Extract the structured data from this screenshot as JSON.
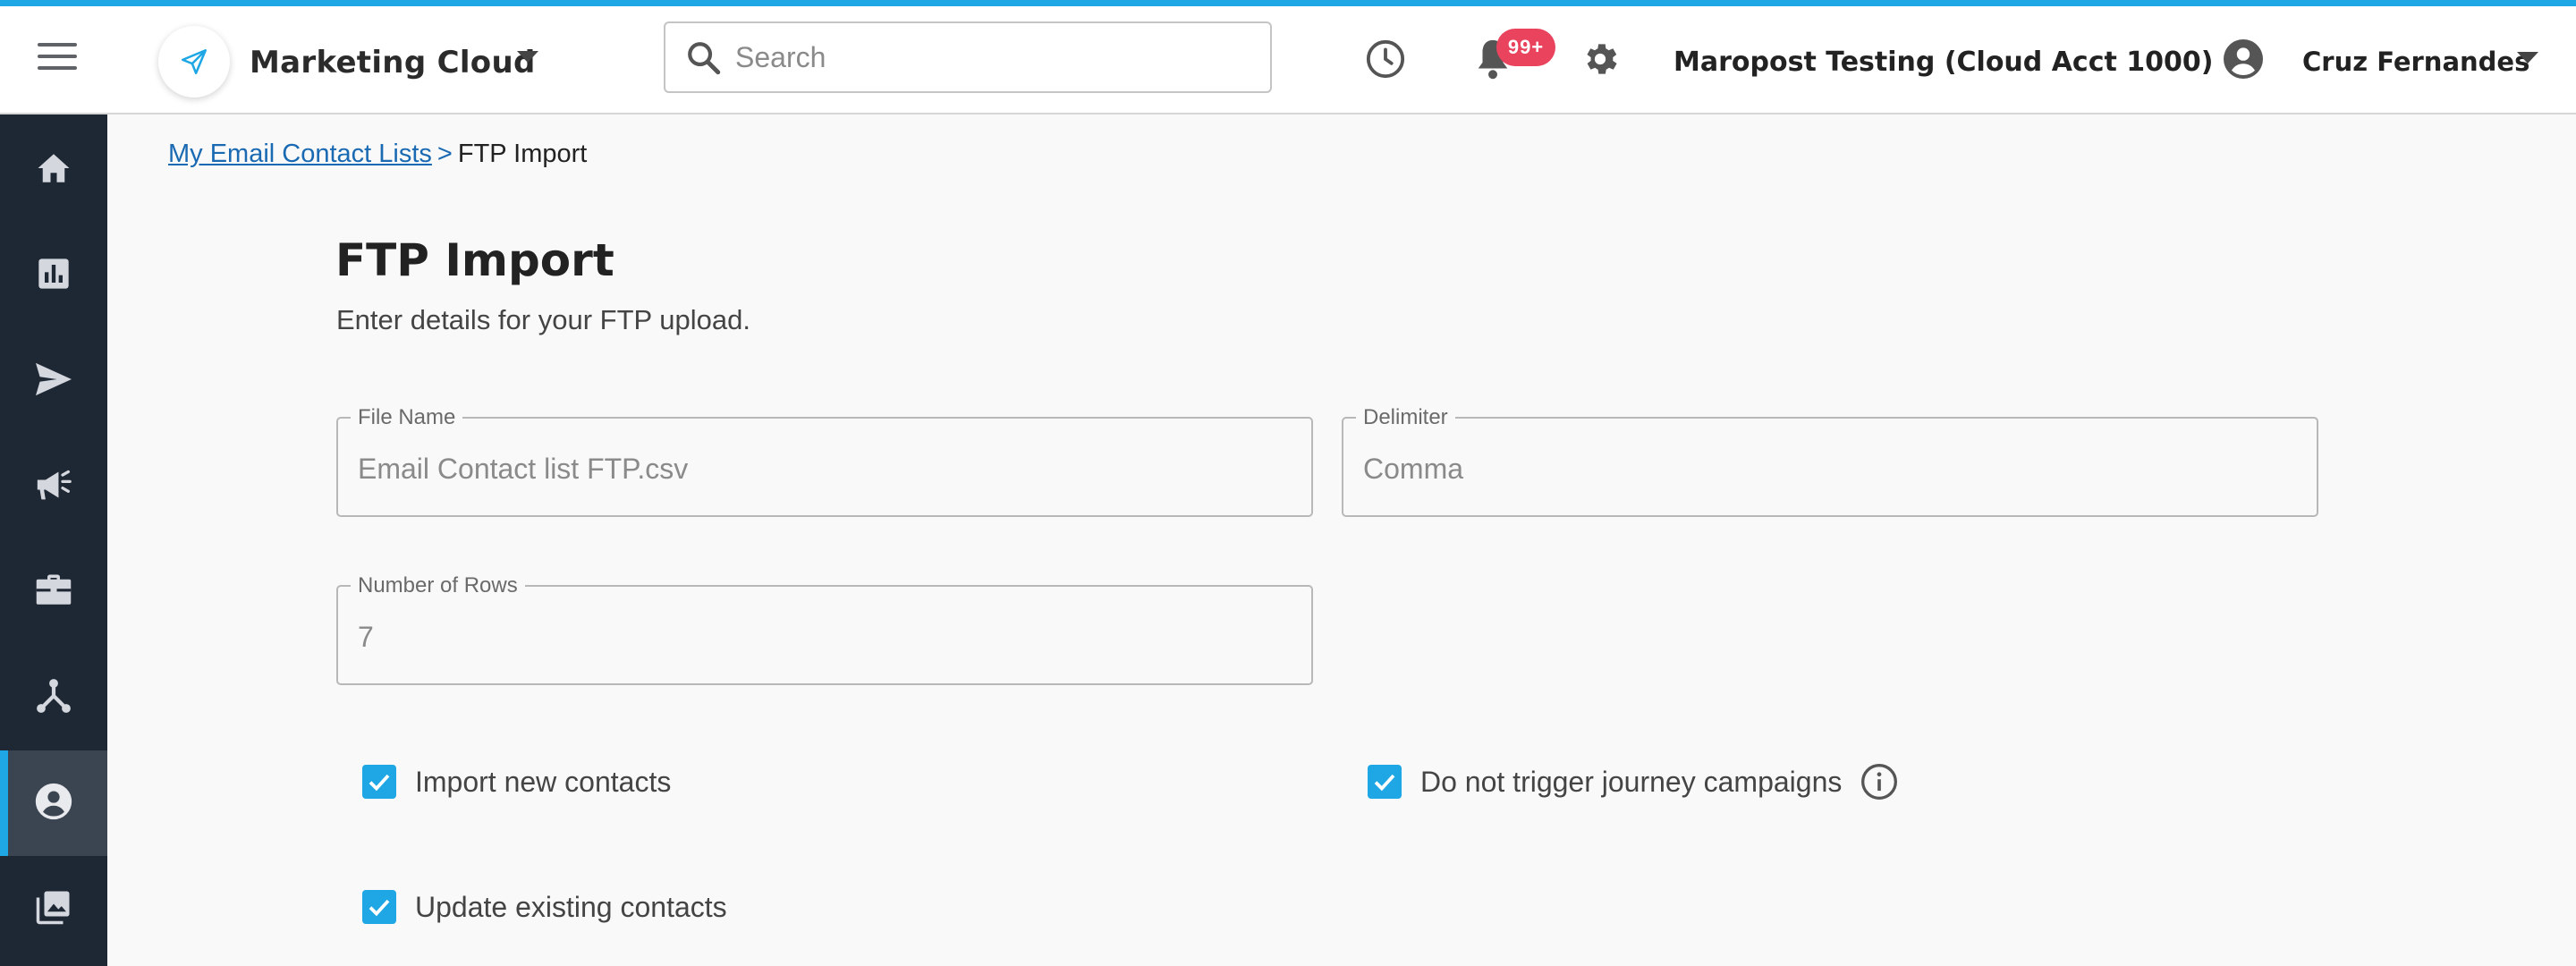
{
  "header": {
    "app_name": "Marketing Cloud",
    "search": {
      "placeholder": "Search"
    },
    "notifications_badge": "99+",
    "account_name": "Maropost Testing (Cloud Acct 1000)",
    "user_name": "Cruz Fernandes"
  },
  "icons": {
    "menu": "hamburger-icon",
    "logo": "paper-plane-icon",
    "app_dropdown": "caret-down-icon",
    "search": "search-icon",
    "history": "clock-icon",
    "notifications": "bell-icon",
    "settings": "gear-icon",
    "account": "account-circle-icon",
    "user_dropdown": "caret-down-icon",
    "info": "info-icon"
  },
  "sidebar": {
    "items": [
      {
        "icon": "home-icon",
        "active": false
      },
      {
        "icon": "bar-chart-icon",
        "active": false
      },
      {
        "icon": "send-icon",
        "active": false
      },
      {
        "icon": "megaphone-icon",
        "active": false
      },
      {
        "icon": "briefcase-icon",
        "active": false
      },
      {
        "icon": "journey-icon",
        "active": false
      },
      {
        "icon": "contacts-icon",
        "active": true
      },
      {
        "icon": "image-library-icon",
        "active": false
      }
    ]
  },
  "breadcrumb": {
    "parent": "My Email Contact Lists",
    "separator": ">",
    "current": "FTP Import"
  },
  "page": {
    "title": "FTP Import",
    "subtitle": "Enter details for your FTP upload."
  },
  "form": {
    "file_name": {
      "label": "File Name",
      "value": "Email Contact list FTP.csv"
    },
    "delimiter": {
      "label": "Delimiter",
      "value": "Comma"
    },
    "rows": {
      "label": "Number of Rows",
      "value": "7"
    },
    "options": {
      "import_new": {
        "label": "Import new contacts",
        "checked": true
      },
      "no_trigger": {
        "label": "Do not trigger journey campaigns",
        "checked": true
      },
      "update_existing": {
        "label": "Update existing contacts",
        "checked": true
      }
    }
  },
  "colors": {
    "accent": "#1ea7e4",
    "sidebar_bg": "#1e2734",
    "sidebar_active": "#3b4451",
    "badge": "#e9435d",
    "link": "#1a6ab3"
  }
}
